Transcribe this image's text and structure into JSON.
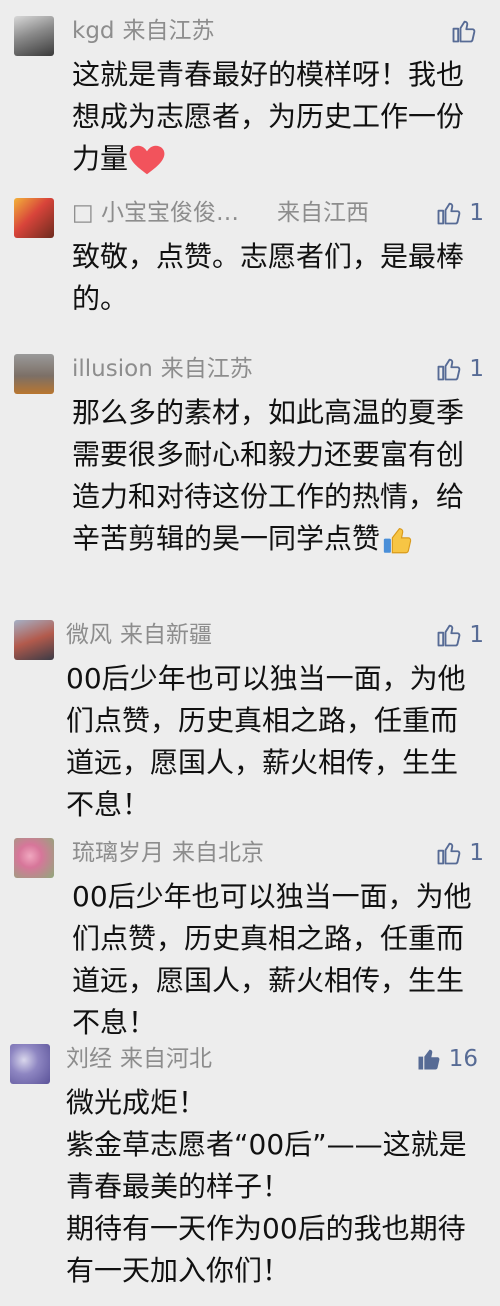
{
  "comments": [
    {
      "author": "kgd",
      "location": "来自江苏",
      "likes": "",
      "text": "这就是青春最好的模样呀！我也想成为志愿者，为历史工作一份力量",
      "emoji": "heart"
    },
    {
      "author": "□ 小宝宝俊俊…",
      "location": "来自江西",
      "likes": "1",
      "text": "致敬，点赞。志愿者们，是最棒的。"
    },
    {
      "author": "illusion",
      "location": "来自江苏",
      "likes": "1",
      "text": "那么多的素材，如此高温的夏季需要很多耐心和毅力还要富有创造力和对待这份工作的热情，给辛苦剪辑的昊一同学点赞",
      "emoji": "thumbs-up"
    },
    {
      "author": "微风",
      "location": "来自新疆",
      "likes": "1",
      "text": "00后少年也可以独当一面，为他们点赞，历史真相之路，任重而道远，愿国人，薪火相传，生生不息！"
    },
    {
      "author": "琉璃岁月",
      "location": "来自北京",
      "likes": "1",
      "text": "00后少年也可以独当一面，为他们点赞，历史真相之路，任重而道远，愿国人，薪火相传，生生不息！"
    },
    {
      "author": "刘经",
      "location": "来自河北",
      "likes": "16",
      "liked": true,
      "text": "微光成炬！\n紫金草志愿者“00后”——这就是青春最美的样子！\n期待有一天作为00后的我也期待有一天加入你们！"
    }
  ],
  "colors": {
    "background": "#ededed",
    "meta_text": "#8d8d8d",
    "like_blue": "#576b95",
    "body_text": "#111111"
  },
  "icons": {
    "like": "thumb-up-outline-icon",
    "liked": "thumb-up-filled-icon",
    "heart": "heart-emoji",
    "thumbs": "thumbs-up-emoji"
  }
}
